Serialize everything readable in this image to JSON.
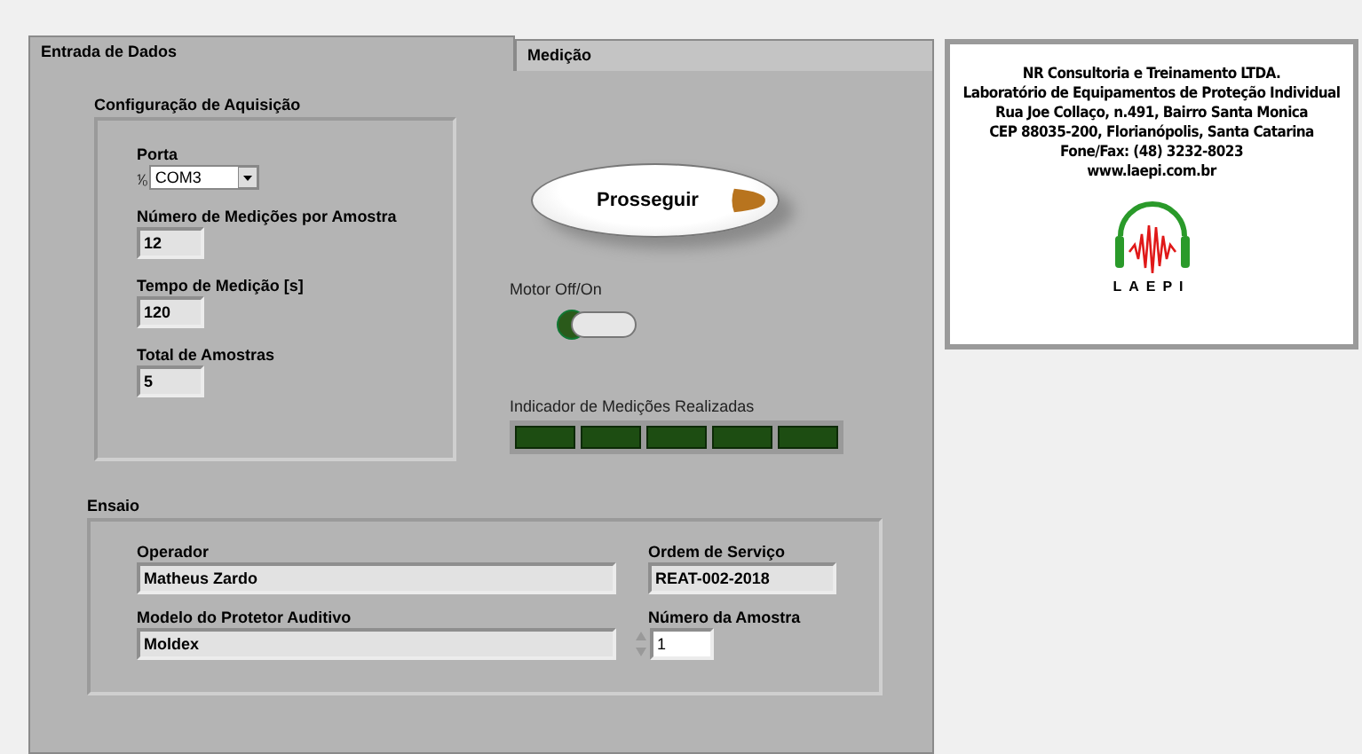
{
  "tabs": [
    {
      "label": "Entrada de Dados",
      "selected": true
    },
    {
      "label": "Medição",
      "selected": false
    }
  ],
  "acquisition": {
    "title": "Configuração de Aquisição",
    "port": {
      "label": "Porta",
      "icon": "⅟₀",
      "value": "COM3"
    },
    "fields": [
      {
        "label": "Número de Medições por Amostra",
        "value": "12"
      },
      {
        "label": "Tempo de Medição [s]",
        "value": "120"
      },
      {
        "label": "Total de Amostras",
        "value": "5"
      }
    ]
  },
  "proceed_button": {
    "label": "Prosseguir"
  },
  "motor": {
    "label": "Motor Off/On",
    "on": false
  },
  "indicator": {
    "label": "Indicador de Medições Realizadas",
    "leds": [
      {
        "on": false
      },
      {
        "on": false
      },
      {
        "on": false
      },
      {
        "on": false
      },
      {
        "on": false
      }
    ]
  },
  "test": {
    "title": "Ensaio",
    "operator": {
      "label": "Operador",
      "value": "Matheus Zardo"
    },
    "service_order": {
      "label": "Ordem de Serviço",
      "value": "REAT-002-2018"
    },
    "model": {
      "label": "Modelo do Protetor Auditivo",
      "value": "Moldex"
    },
    "sample_number": {
      "label": "Número da Amostra",
      "value": "1"
    }
  },
  "info": {
    "lines": [
      "NR Consultoria e Treinamento LTDA.",
      "Laboratório de Equipamentos de Proteção Individual",
      "Rua Joe Collaço, n.491, Bairro Santa Monica",
      "CEP 88035-200, Florianópolis, Santa Catarina",
      "Fone/Fax: (48) 3232-8023",
      "www.laepi.com.br"
    ],
    "logo_text": "LAEPI"
  }
}
